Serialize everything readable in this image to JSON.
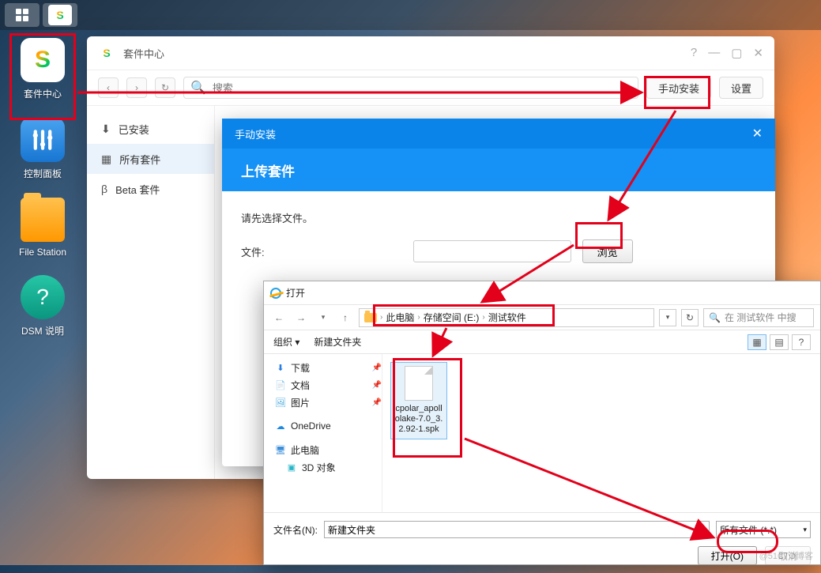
{
  "taskbar": {
    "pkg_glyph": "S"
  },
  "desktop": [
    {
      "id": "pkg-center",
      "label": "套件中心"
    },
    {
      "id": "control-panel",
      "label": "控制面板"
    },
    {
      "id": "file-station",
      "label": "File Station"
    },
    {
      "id": "dsm-help",
      "label": "DSM 说明"
    }
  ],
  "pkg_win": {
    "title": "套件中心",
    "search_placeholder": "搜索",
    "manual_install": "手动安装",
    "settings": "设置",
    "sidebar": {
      "installed": "已安装",
      "all": "所有套件",
      "beta": "Beta 套件"
    }
  },
  "manual_install": {
    "titlebar": "手动安装",
    "header": "上传套件",
    "prompt": "请先选择文件。",
    "file_label": "文件:",
    "browse": "浏览"
  },
  "open_dialog": {
    "title": "打开",
    "breadcrumb": [
      "此电脑",
      "存储空间 (E:)",
      "测试软件"
    ],
    "search_placeholder": "在 测试软件 中搜",
    "organize": "组织",
    "new_folder": "新建文件夹",
    "tree": {
      "downloads": "下载",
      "documents": "文档",
      "pictures": "图片",
      "onedrive": "OneDrive",
      "this_pc": "此电脑",
      "objects_3d": "3D 对象"
    },
    "file": {
      "name": "cpolar_apollolake-7.0_3.2.92-1.spk"
    },
    "filename_label": "文件名(N):",
    "filename_value": "新建文件夹",
    "filter": "所有文件 (*.*)",
    "open_btn": "打开(O)",
    "cancel_btn": "取消"
  },
  "watermark": "@51CTO博客"
}
